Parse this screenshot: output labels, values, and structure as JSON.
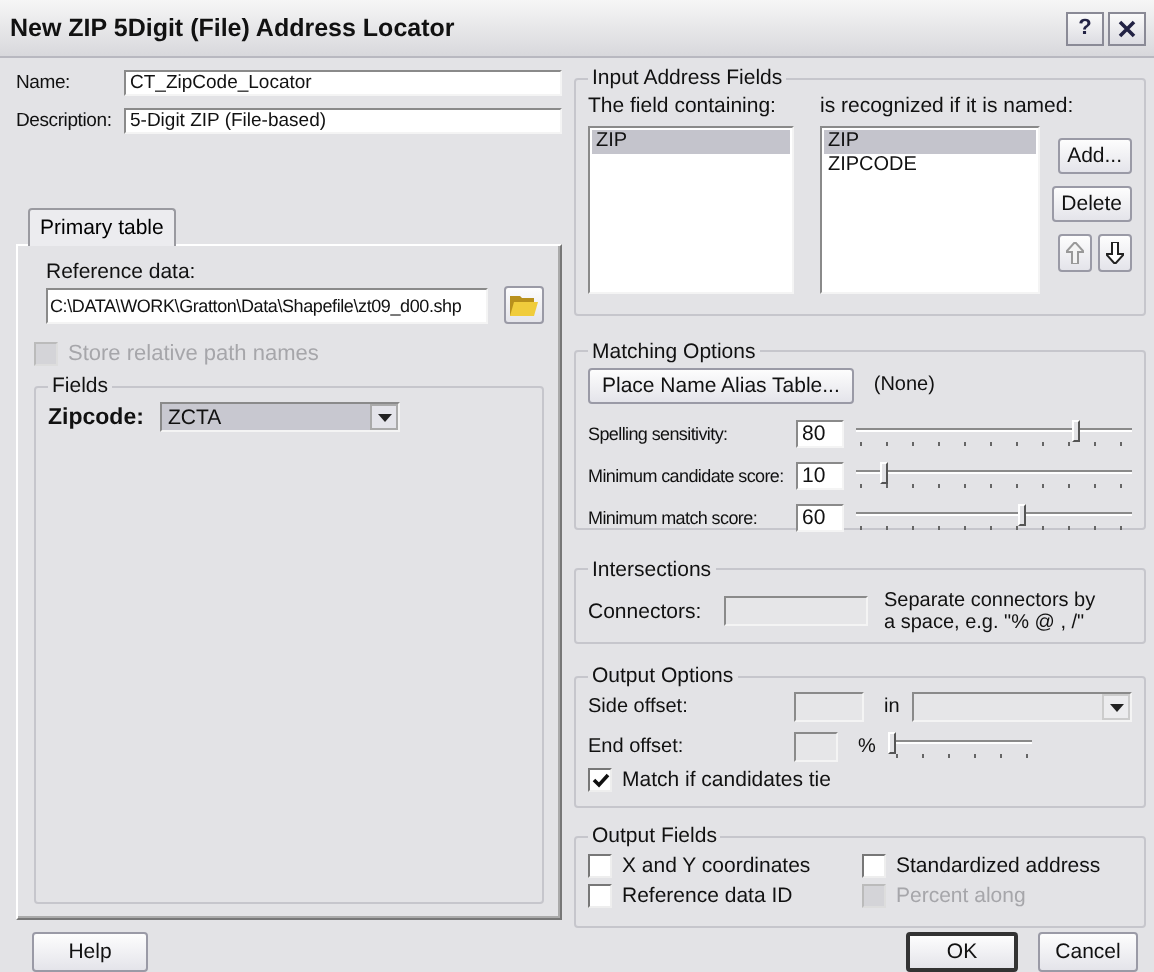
{
  "window": {
    "title": "New ZIP 5Digit (File) Address Locator",
    "help_button": "?"
  },
  "name": {
    "label": "Name:",
    "value": "CT_ZipCode_Locator"
  },
  "description": {
    "label": "Description:",
    "value": "5-Digit ZIP (File-based)"
  },
  "tabs": [
    {
      "label": "Primary table",
      "selected": true
    }
  ],
  "primary_table": {
    "reference_data": {
      "label": "Reference data:",
      "value": "C:\\DATA\\WORK\\Gratton\\Data\\Shapefile\\zt09_d00.shp"
    },
    "store_relative": {
      "label": "Store relative path names",
      "checked": false,
      "disabled": true
    },
    "fields_group": {
      "title": "Fields",
      "zipcode": {
        "label": "Zipcode:",
        "value": "ZCTA"
      }
    }
  },
  "help": "Help",
  "input_address_fields": {
    "title": "Input Address Fields",
    "field_header": "The field containing:",
    "alias_header": "is recognized if it is named:",
    "fields": [
      {
        "text": "ZIP",
        "selected": true
      }
    ],
    "aliases": [
      {
        "text": "ZIP",
        "selected": true
      },
      {
        "text": "ZIPCODE",
        "selected": false
      }
    ],
    "buttons": [
      "Add...",
      "Delete"
    ]
  },
  "matching_options": {
    "title": "Matching Options",
    "alias_button": "Place Name Alias Table...",
    "alias_value": "(None)",
    "sliders": [
      {
        "label": "Spelling sensitivity:",
        "value": "80",
        "level": 0.8
      },
      {
        "label": "Minimum candidate score:",
        "value": "10",
        "level": 0.1
      },
      {
        "label": "Minimum match score:",
        "value": "60",
        "level": 0.6
      }
    ]
  },
  "intersections": {
    "title": "Intersections",
    "label": "Connectors:",
    "hint": "Separate connectors by a space, e.g. \"% @ , /\""
  },
  "output_options": {
    "title": "Output Options",
    "side_offset": {
      "label": "Side offset:",
      "unit": "in"
    },
    "end_offset": {
      "label": "End offset:",
      "unit": "%",
      "level": 0
    },
    "match_tie": {
      "label": "Match if candidates tie",
      "checked": true
    }
  },
  "output_fields": {
    "title": "Output Fields",
    "checkboxes": [
      {
        "label": "X and Y coordinates",
        "checked": false,
        "disabled": false
      },
      {
        "label": "Standardized address",
        "checked": false,
        "disabled": false
      },
      {
        "label": "Reference data ID",
        "checked": false,
        "disabled": false
      },
      {
        "label": "Percent along",
        "checked": false,
        "disabled": true
      }
    ]
  },
  "ok": "OK",
  "cancel": "Cancel"
}
